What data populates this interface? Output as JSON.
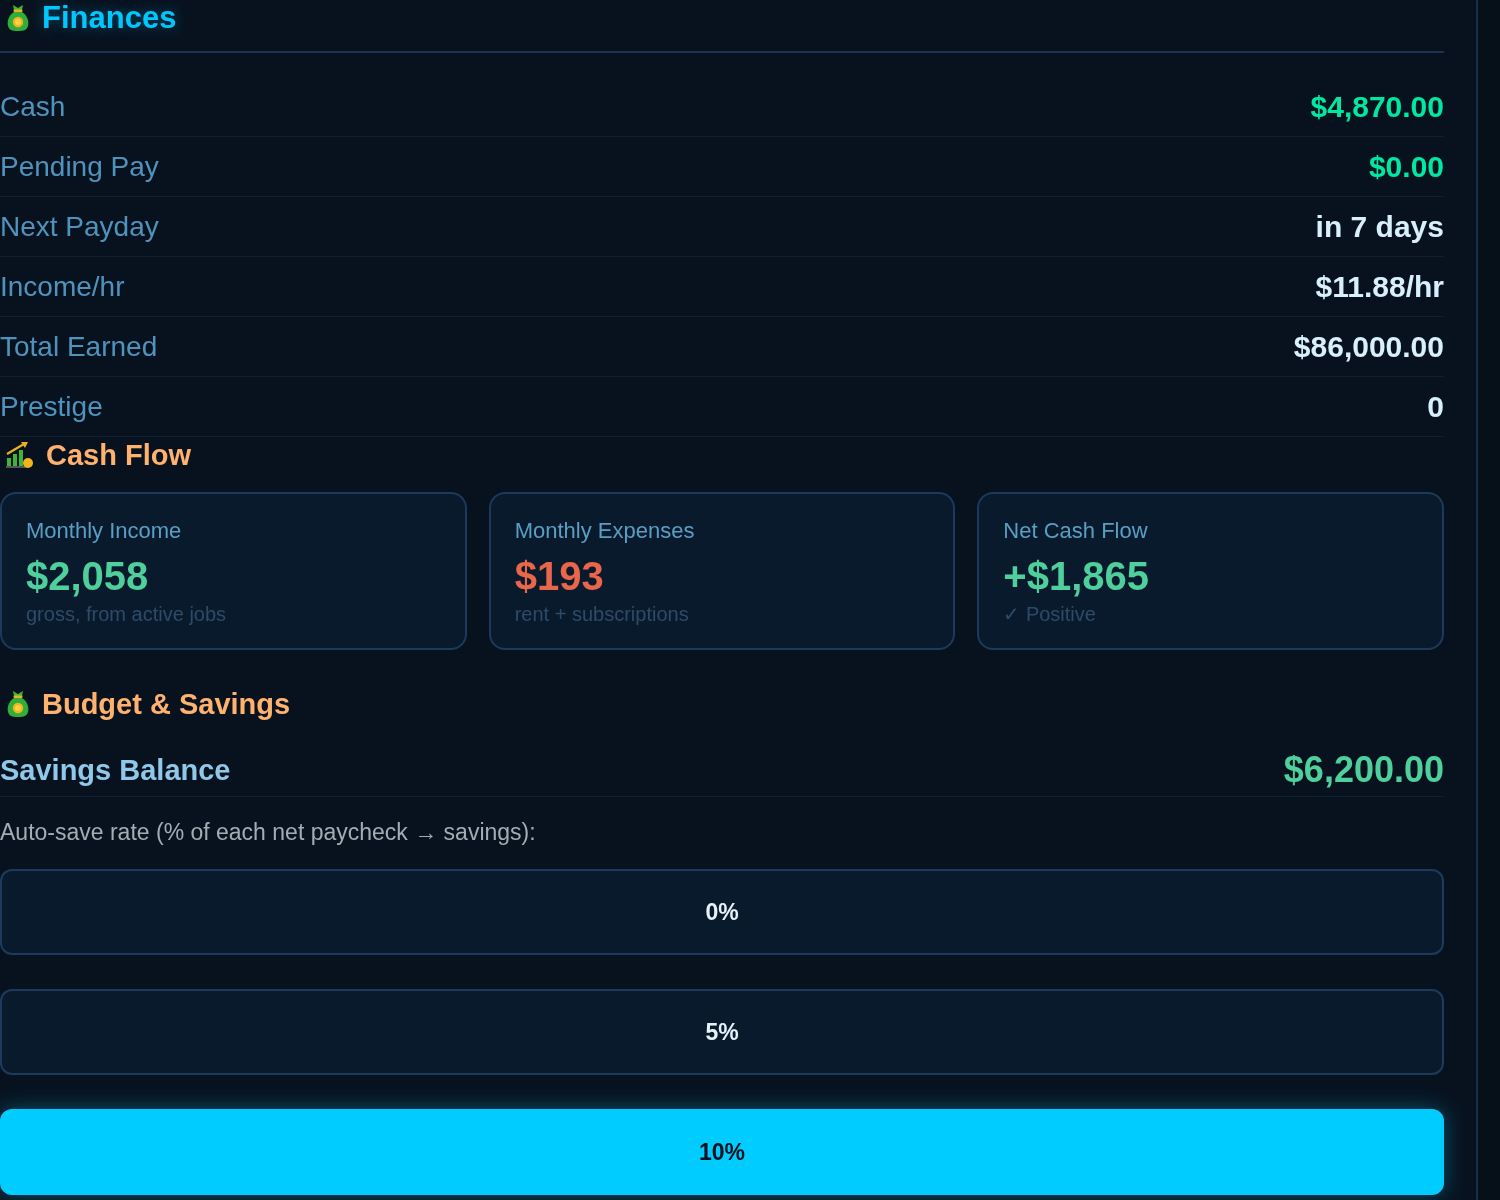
{
  "finances": {
    "title": "Finances",
    "rows": [
      {
        "label": "Cash",
        "value": "$4,870.00",
        "color": "#00e8a2"
      },
      {
        "label": "Pending Pay",
        "value": "$0.00",
        "color": "#00e8a2"
      },
      {
        "label": "Next Payday",
        "value": "in 7 days",
        "color": "#d8f0fb"
      },
      {
        "label": "Income/hr",
        "value": "$11.88/hr",
        "color": "#d8f0fb"
      },
      {
        "label": "Total Earned",
        "value": "$86,000.00",
        "color": "#d8f0fb"
      },
      {
        "label": "Prestige",
        "value": "0",
        "color": "#d8f0fb"
      }
    ]
  },
  "cash_flow": {
    "title": "Cash Flow",
    "cards": [
      {
        "label": "Monthly Income",
        "value": "$2,058",
        "note": "gross, from active jobs",
        "color": "#4ecf9c"
      },
      {
        "label": "Monthly Expenses",
        "value": "$193",
        "note": "rent + subscriptions",
        "color": "#e8664a"
      },
      {
        "label": "Net Cash Flow",
        "value": "+$1,865",
        "note": "✓ Positive",
        "color": "#4ecf9c"
      }
    ]
  },
  "budget": {
    "title": "Budget & Savings",
    "savings_label": "Savings Balance",
    "savings_value": "$6,200.00",
    "auto_save_label": "Auto-save rate (% of each net paycheck → savings):",
    "rates": [
      {
        "label": "0%",
        "selected": false
      },
      {
        "label": "5%",
        "selected": false
      },
      {
        "label": "10%",
        "selected": true
      }
    ]
  }
}
